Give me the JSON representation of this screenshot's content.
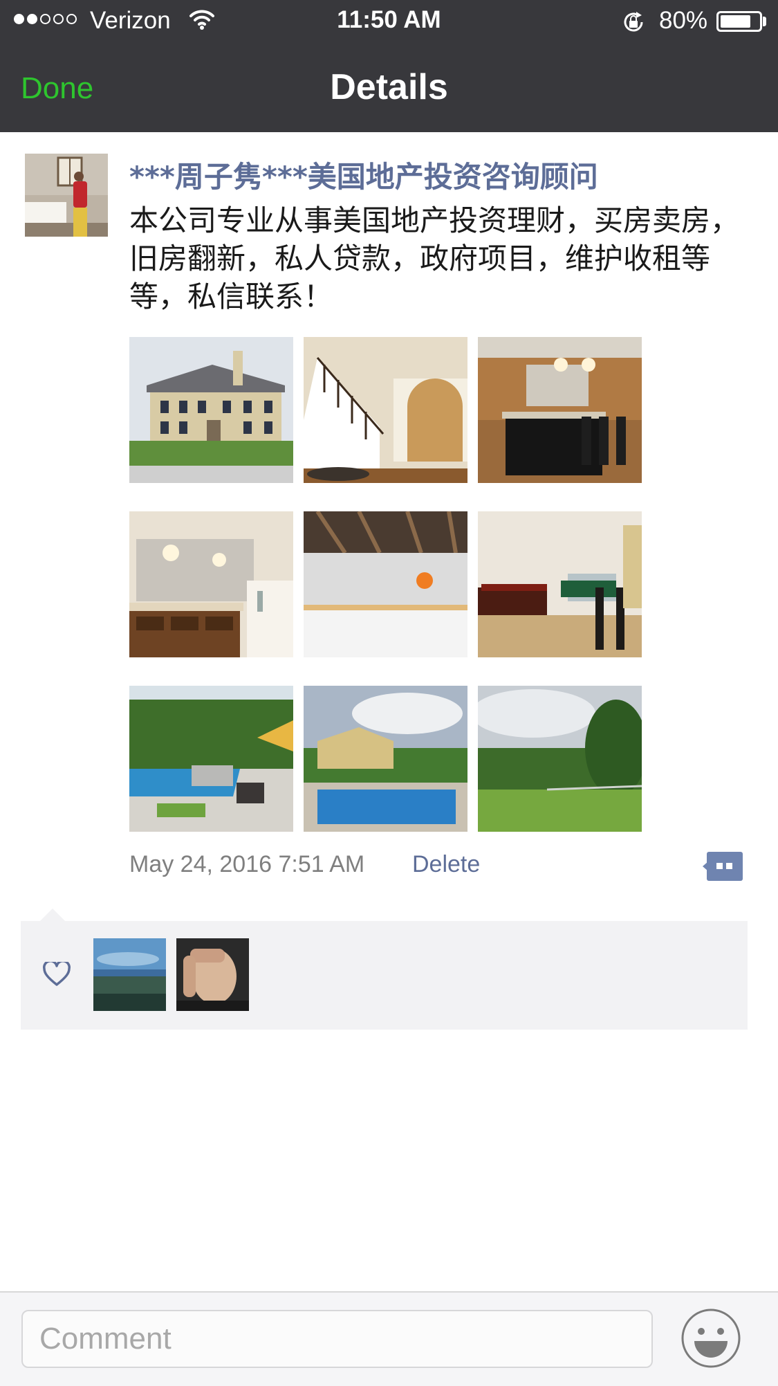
{
  "status_bar": {
    "carrier": "Verizon",
    "time": "11:50 AM",
    "battery_percent": "80%",
    "battery_level": 0.8,
    "signal_bars": 2,
    "icons": [
      "wifi-icon",
      "rotation-lock-icon",
      "battery-icon"
    ]
  },
  "nav": {
    "done_label": "Done",
    "title": "Details"
  },
  "post": {
    "author": "***周子隽***美国地产投资咨询顾问",
    "content": "本公司专业从事美国地产投资理财，买房卖房，旧房翻新，私人贷款，政府项目，维护收租等等，私信联系！",
    "timestamp": "May 24, 2016 7:51 AM",
    "delete_label": "Delete",
    "photos": [
      "house-exterior",
      "staircase",
      "kitchen",
      "bathroom",
      "basement-rink",
      "game-room",
      "pool-patio",
      "pool-backyard",
      "lawn"
    ]
  },
  "likes": {
    "icon": "heart-icon",
    "users": [
      "landscape-avatar",
      "man-avatar"
    ]
  },
  "comment_bar": {
    "placeholder": "Comment",
    "emoji_icon": "smiley-icon"
  },
  "colors": {
    "nav_background": "#38383c",
    "done_green": "#2ec52e",
    "link_blue": "#5d6d97",
    "likes_background": "#f2f2f4"
  }
}
